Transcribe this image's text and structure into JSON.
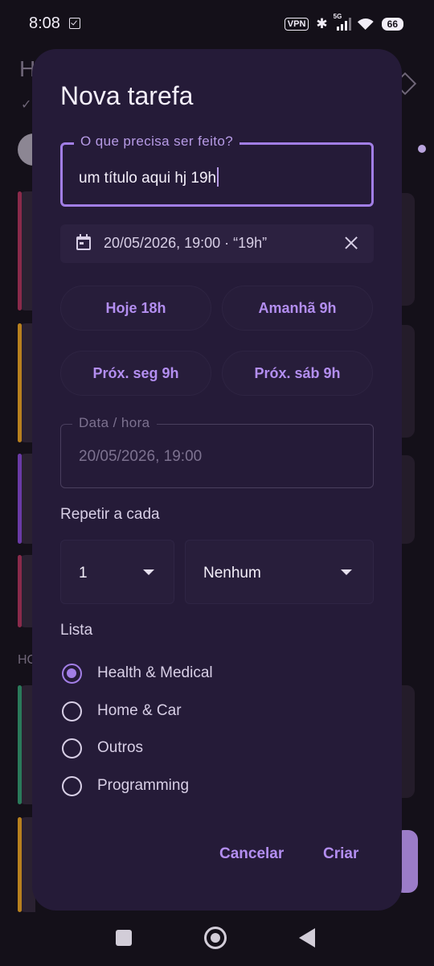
{
  "status_bar": {
    "time": "8:08",
    "vpn": "VPN",
    "network": "5G",
    "battery": "66"
  },
  "background": {
    "title_initial": "H",
    "section_initial": "HC"
  },
  "dialog": {
    "title": "Nova tarefa",
    "title_field": {
      "label": "O que precisa ser feito?",
      "value": "um título aqui hj 19h"
    },
    "parsed_date_chip": "20/05/2026, 19:00 · “19h”",
    "quick_buttons": [
      "Hoje 18h",
      "Amanhã 9h",
      "Próx. seg 9h",
      "Próx. sáb 9h"
    ],
    "datetime_field": {
      "label": "Data / hora",
      "value": "20/05/2026, 19:00"
    },
    "repeat": {
      "label": "Repetir a cada",
      "interval": "1",
      "unit": "Nenhum"
    },
    "list": {
      "label": "Lista",
      "options": [
        "Health & Medical",
        "Home & Car",
        "Outros",
        "Programming"
      ],
      "selected": "Health & Medical"
    },
    "actions": {
      "cancel": "Cancelar",
      "create": "Criar"
    }
  },
  "colors": {
    "accent": "#a27ee6",
    "dialog_bg": "#251b38",
    "screen_bg": "#141019"
  }
}
